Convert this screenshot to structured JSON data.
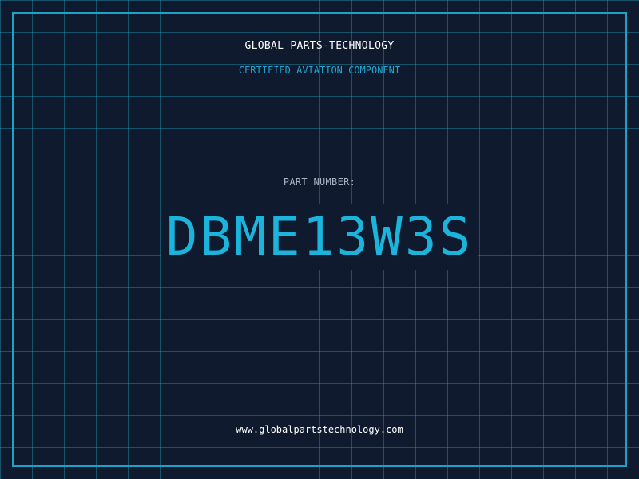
{
  "header": {
    "brand": "GLOBAL PARTS-TECHNOLOGY",
    "subtitle": "CERTIFIED AVIATION COMPONENT"
  },
  "part": {
    "label": "PART NUMBER:",
    "number": "DBME13W3S"
  },
  "footer": {
    "url": "www.globalpartstechnology.com"
  },
  "colors": {
    "background": "#101a2e",
    "grid": "#22a0be",
    "frame": "#1aa3c9",
    "accent": "#1bb4dc",
    "label": "#a6b3c2",
    "text": "#ffffff"
  }
}
